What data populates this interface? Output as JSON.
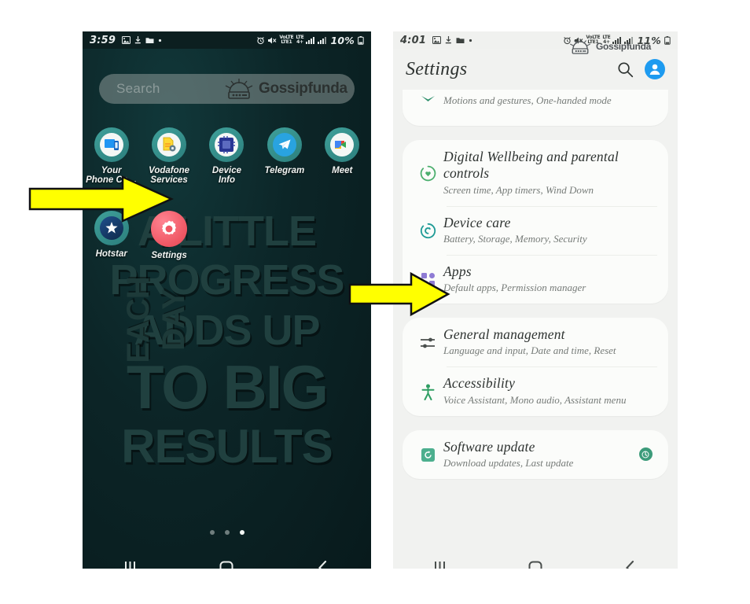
{
  "tutorial": {
    "step_count": 2,
    "arrow_color": "#ffff00",
    "arrows": [
      {
        "name": "arrow-to-settings-app",
        "points_to": "Settings",
        "direction": "right"
      },
      {
        "name": "arrow-to-apps-row",
        "points_to": "Apps",
        "direction": "right"
      }
    ]
  },
  "phone_left": {
    "screen_name": "Home screen",
    "status_bar": {
      "time": "3:59",
      "battery_percent": "10%",
      "left_icons": [
        "image-icon",
        "download-icon",
        "folder-icon",
        "dot-icon"
      ],
      "right_icons": [
        "alarm-icon",
        "mute-icon",
        "volte-icon",
        "lte-icon",
        "signal-bars-icon",
        "signal-bars-2-icon",
        "battery-icon"
      ],
      "network_labels": [
        "VoLTE",
        "LTE1",
        "LTE",
        "4+"
      ]
    },
    "search": {
      "placeholder": "Search",
      "watermark": "Gossipfunda"
    },
    "wallpaper": {
      "line1": "A LITTLE",
      "line2": "PROGRESS",
      "line3": "ADDS UP",
      "line4": "TO BIG",
      "line5": "RESULTS",
      "vertical": "EACH DAY",
      "background_color": "#0c2527",
      "text_color": "#20403f"
    },
    "apps_row_1": [
      {
        "label": "Your\nPhone Co…",
        "icon": "your-phone-companion-icon"
      },
      {
        "label": "Vodafone\nServices",
        "icon": "vodafone-services-icon"
      },
      {
        "label": "Device\nInfo",
        "icon": "device-info-icon"
      },
      {
        "label": "Telegram",
        "icon": "telegram-icon"
      },
      {
        "label": "Meet",
        "icon": "google-meet-icon"
      }
    ],
    "apps_row_2": [
      {
        "label": "Hotstar",
        "icon": "hotstar-icon"
      },
      {
        "label": "Settings",
        "icon": "settings-gear-icon"
      }
    ],
    "page_dots": {
      "total": 3,
      "active_index": 2
    },
    "nav_bar": [
      "recents-icon",
      "home-icon",
      "back-icon"
    ]
  },
  "phone_right": {
    "screen_name": "Settings",
    "status_bar": {
      "time": "4:01",
      "battery_percent": "11%",
      "left_icons": [
        "image-icon",
        "download-icon",
        "folder-icon",
        "dot-icon"
      ],
      "right_icons": [
        "alarm-icon",
        "mute-icon",
        "volte-icon",
        "lte-icon",
        "signal-bars-icon",
        "signal-bars-2-icon",
        "battery-icon"
      ],
      "network_labels": [
        "VoLTE",
        "LTE1",
        "LTE",
        "4+"
      ]
    },
    "header": {
      "title": "Settings",
      "search_icon": "search-icon",
      "avatar_icon": "account-avatar-icon",
      "watermark": "Gossipfunda"
    },
    "settings_groups": [
      {
        "group": "advanced-features-partial",
        "items": [
          {
            "title": "",
            "subtitle": "Motions and gestures, One-handed mode",
            "icon": "advanced-features-icon",
            "icon_color": "#2f8f6c",
            "clipped": true
          }
        ]
      },
      {
        "group": "wellbeing-apps",
        "items": [
          {
            "title": "Digital Wellbeing and parental controls",
            "subtitle": "Screen time, App timers, Wind Down",
            "icon": "digital-wellbeing-heart-icon",
            "icon_color": "#4caf6e"
          },
          {
            "title": "Device care",
            "subtitle": "Battery, Storage, Memory, Security",
            "icon": "device-care-refresh-icon",
            "icon_color": "#1f9b96"
          },
          {
            "title": "Apps",
            "subtitle": "Default apps, Permission manager",
            "icon": "apps-icon",
            "icon_color": "#7b61c9",
            "highlighted_by_arrow": true
          }
        ]
      },
      {
        "group": "management-accessibility",
        "items": [
          {
            "title": "General management",
            "subtitle": "Language and input, Date and time, Reset",
            "icon": "general-management-sliders-icon",
            "icon_color": "#4a4f4d"
          },
          {
            "title": "Accessibility",
            "subtitle": "Voice Assistant, Mono audio, Assistant menu",
            "icon": "accessibility-person-icon",
            "icon_color": "#2f9e63"
          }
        ]
      },
      {
        "group": "software-update",
        "items": [
          {
            "title": "Software update",
            "subtitle": "Download updates, Last update",
            "icon": "software-update-icon",
            "icon_color": "#3c9b7a",
            "badge": "update-available-badge"
          }
        ]
      }
    ],
    "nav_bar": [
      "recents-icon",
      "home-icon",
      "back-icon"
    ]
  }
}
